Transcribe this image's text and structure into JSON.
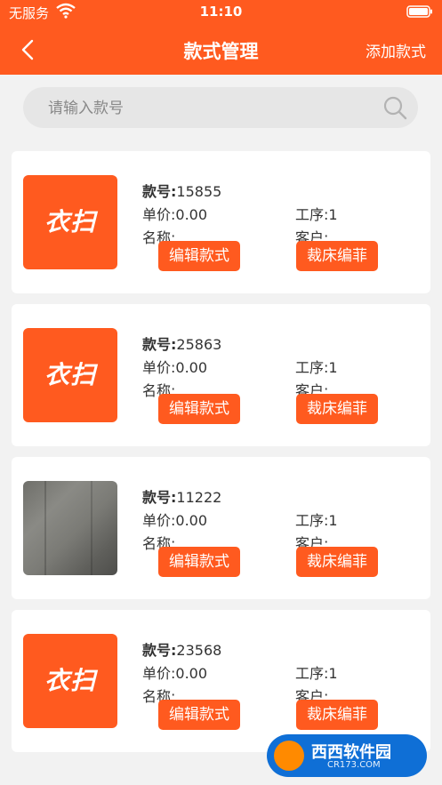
{
  "status_bar": {
    "carrier": "无服务",
    "time": "11:10"
  },
  "header": {
    "title": "款式管理",
    "action": "添加款式"
  },
  "search": {
    "placeholder": "请输入款号"
  },
  "labels": {
    "code": "款号:",
    "price": "单价:",
    "name": "名称:",
    "process": "工序:",
    "customer": "客户:",
    "edit_button": "编辑款式",
    "cut_button": "裁床编菲"
  },
  "thumb_logo_text": "衣扫",
  "items": [
    {
      "code": "15855",
      "price": "0.00",
      "process": "1",
      "name": "",
      "customer": "",
      "thumb": "logo"
    },
    {
      "code": "25863",
      "price": "0.00",
      "process": "1",
      "name": "",
      "customer": "",
      "thumb": "logo"
    },
    {
      "code": "11222",
      "price": "0.00",
      "process": "1",
      "name": "",
      "customer": "",
      "thumb": "photo"
    },
    {
      "code": "23568",
      "price": "0.00",
      "process": "1",
      "name": "",
      "customer": "",
      "thumb": "logo"
    }
  ],
  "watermark": {
    "text": "西西软件园",
    "sub": "CR173.COM"
  },
  "colors": {
    "accent": "#ff5a1f",
    "background": "#f2f2f2"
  }
}
